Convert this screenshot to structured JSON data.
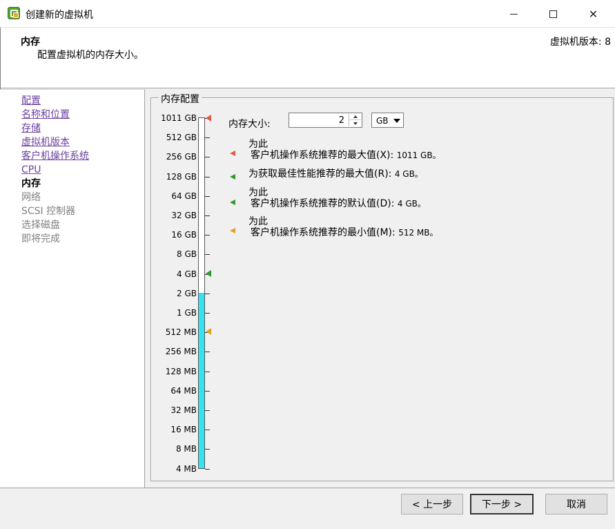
{
  "window": {
    "title": "创建新的虚拟机",
    "icon": "vmware-icon"
  },
  "header": {
    "title": "内存",
    "subtitle": "配置虚拟机的内存大小。",
    "vm_version": "虚拟机版本: 8"
  },
  "sidebar": {
    "items": [
      {
        "label": "配置",
        "state": "link"
      },
      {
        "label": "名称和位置",
        "state": "link"
      },
      {
        "label": "存储",
        "state": "link"
      },
      {
        "label": "虚拟机版本",
        "state": "link"
      },
      {
        "label": "客户机操作系统",
        "state": "link"
      },
      {
        "label": "CPU",
        "state": "link"
      },
      {
        "label": "内存",
        "state": "current"
      },
      {
        "label": "网络",
        "state": "disabled"
      },
      {
        "label": "SCSI 控制器",
        "state": "disabled"
      },
      {
        "label": "选择磁盘",
        "state": "disabled"
      },
      {
        "label": "即将完成",
        "state": "disabled"
      }
    ]
  },
  "memory_config": {
    "group_title": "内存配置",
    "size_label": "内存大小:",
    "size_value": "2",
    "unit": "GB",
    "scale_labels": [
      "1011 GB",
      "512 GB",
      "256 GB",
      "128 GB",
      "64 GB",
      "32 GB",
      "16 GB",
      "8 GB",
      "4 GB",
      "2 GB",
      "1 GB",
      "512 MB",
      "256 MB",
      "128 MB",
      "64 MB",
      "32 MB",
      "16 MB",
      "8 MB",
      "4 MB"
    ],
    "selected_level": "2 GB",
    "fill_color": "#33e3f0",
    "legend": [
      {
        "line1": "为此",
        "line2": "客户机操作系统推荐的最大值(X):",
        "value": "1011 GB。",
        "color": "#e05a48"
      },
      {
        "line1": "",
        "line2": "为获取最佳性能推荐的最大值(R):",
        "value": "4 GB。",
        "color": "#2c9a2c"
      },
      {
        "line1": "为此",
        "line2": "客户机操作系统推荐的默认值(D):",
        "value": "4 GB。",
        "color": "#2c9a2c"
      },
      {
        "line1": "为此",
        "line2": "客户机操作系统推荐的最小值(M):",
        "value": "512 MB。",
        "color": "#e0a020"
      }
    ]
  },
  "buttons": {
    "back": "< 上一步",
    "next": "下一步 >",
    "cancel": "取消"
  }
}
